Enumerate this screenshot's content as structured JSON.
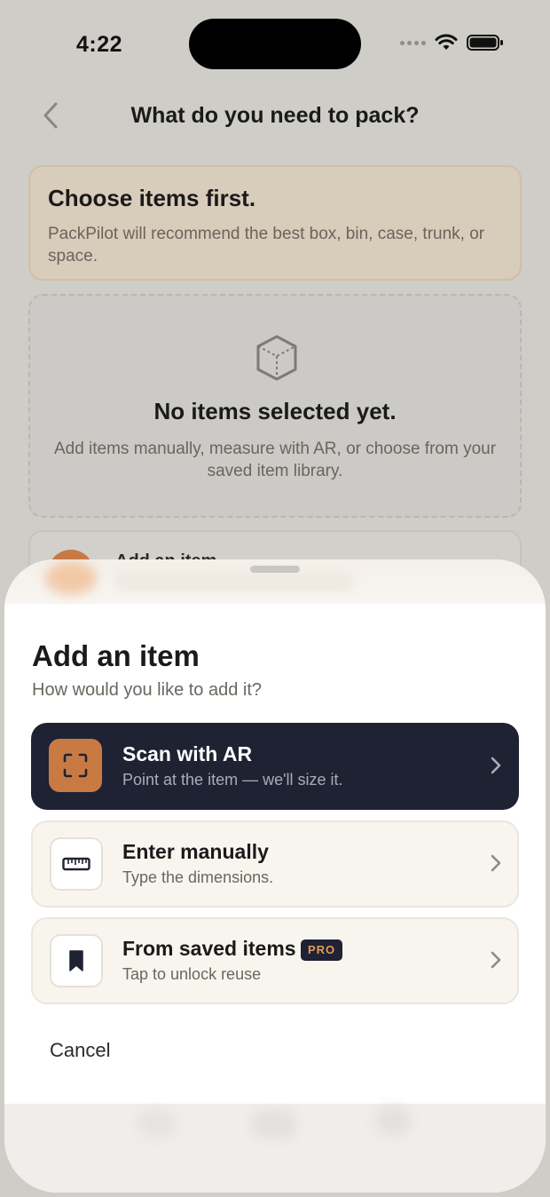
{
  "status": {
    "time": "4:22"
  },
  "header": {
    "title": "What do you need to pack?"
  },
  "hint": {
    "title": "Choose items first.",
    "text": "PackPilot will recommend the best box, bin, case, trunk, or space."
  },
  "empty_state": {
    "title": "No items selected yet.",
    "text": "Add items manually, measure with AR, or choose from your saved item library."
  },
  "background_row": {
    "label": "Add an item"
  },
  "sheet": {
    "title": "Add an item",
    "subtitle": "How would you like to add it?",
    "options": [
      {
        "title": "Scan with AR",
        "subtitle": "Point at the item — we'll size it.",
        "icon": "scan-frame-icon"
      },
      {
        "title": "Enter manually",
        "subtitle": "Type the dimensions.",
        "icon": "ruler-icon"
      },
      {
        "title": "From saved items",
        "subtitle": "Tap to unlock reuse",
        "icon": "bookmark-icon",
        "badge": "PRO"
      }
    ],
    "cancel": "Cancel"
  },
  "colors": {
    "accent": "#c97a43",
    "dark": "#1e2233",
    "background": "#cfcdc8",
    "hint_bg": "#d8ccbb"
  }
}
